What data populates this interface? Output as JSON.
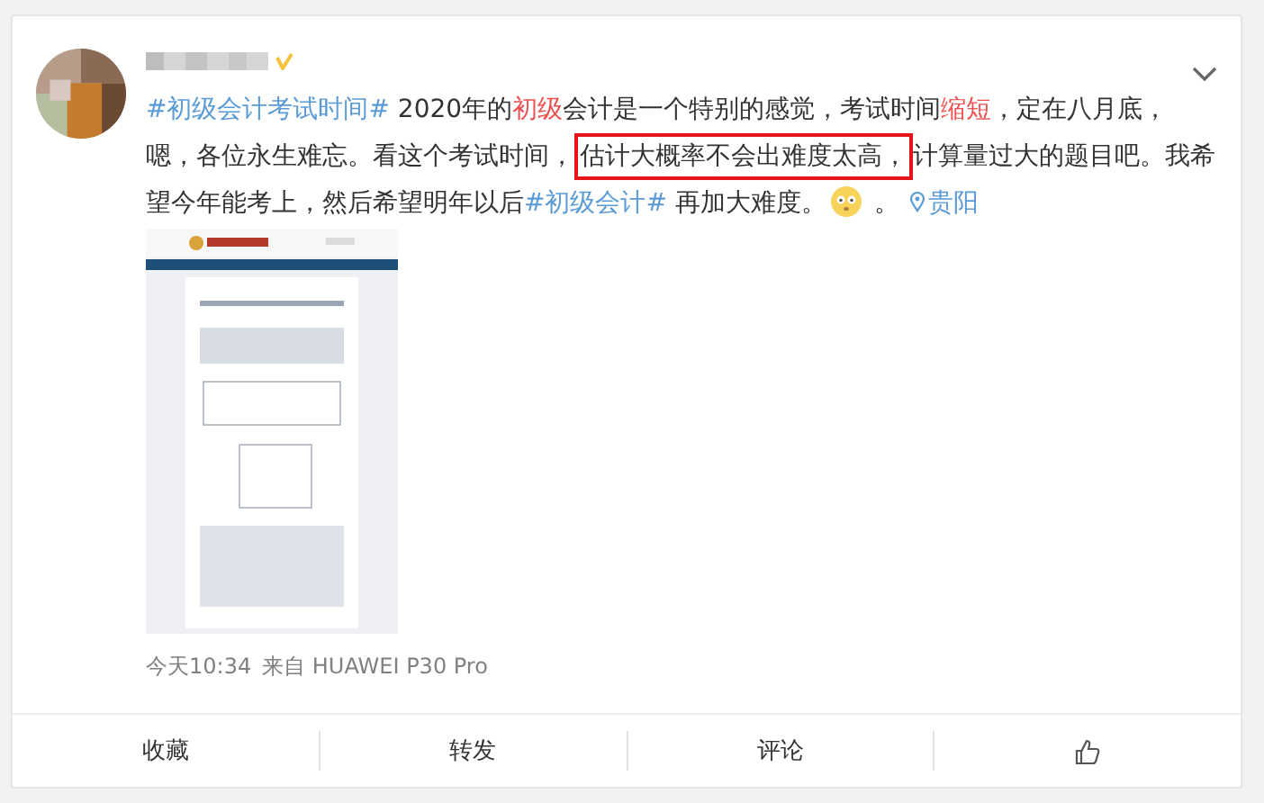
{
  "post": {
    "lines": [
      [
        {
          "kind": "topic",
          "text": "#初级会计考试时间#"
        },
        {
          "kind": "plain",
          "text": " 2020年的"
        },
        {
          "kind": "keyword",
          "text": "初级"
        },
        {
          "kind": "plain",
          "text": "会计是一个特别的感觉，考试时间"
        },
        {
          "kind": "keyword",
          "text": "缩短"
        },
        {
          "kind": "plain",
          "text": "，定在八月底，"
        }
      ],
      [
        {
          "kind": "plain",
          "text": "嗯，各位永生难忘。看这个考试时间，"
        },
        {
          "kind": "boxed",
          "text": "估计大概率不会出难度太高，"
        },
        {
          "kind": "plain",
          "text": "计算量过大的题目吧。我希"
        }
      ],
      [
        {
          "kind": "plain",
          "text": "望今年能考上，然后希望明年以后"
        },
        {
          "kind": "topic",
          "text": "#初级会计#"
        },
        {
          "kind": "plain",
          "text": " 再加大难度。"
        },
        {
          "kind": "emoji"
        },
        {
          "kind": "plain",
          "text": " 。"
        },
        {
          "kind": "location",
          "text": "贵阳"
        }
      ]
    ],
    "images": [
      {
        "kind": "picture"
      }
    ],
    "time": "今天10:34",
    "source": "来自 HUAWEI P30 Pro"
  },
  "actions": [
    {
      "kind": "text",
      "label": "收藏"
    },
    {
      "kind": "text",
      "label": "转发"
    },
    {
      "kind": "text",
      "label": "评论"
    },
    {
      "kind": "like"
    }
  ]
}
